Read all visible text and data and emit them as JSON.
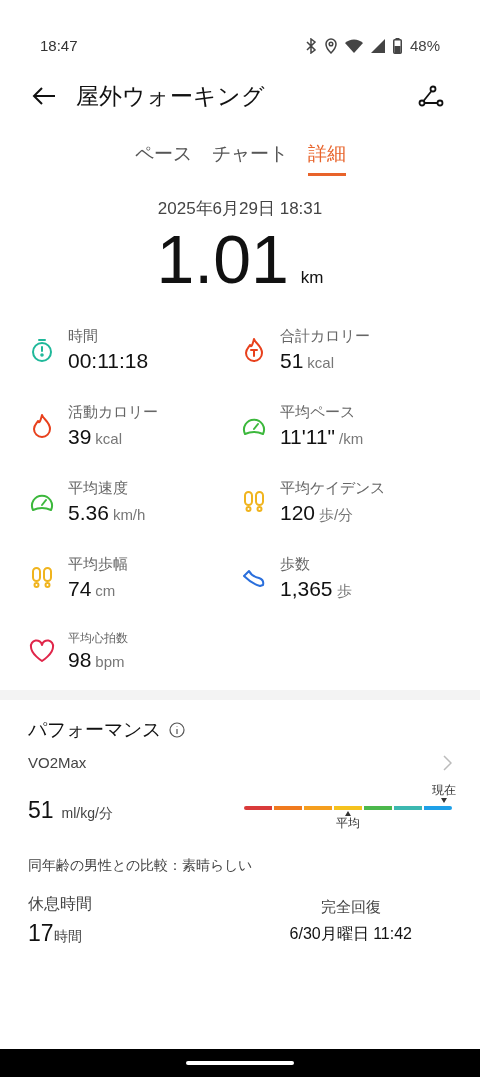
{
  "status_bar": {
    "time": "18:47",
    "battery": "48%"
  },
  "header": {
    "title": "屋外ウォーキング"
  },
  "tabs": [
    {
      "label": "ペース",
      "selected": false
    },
    {
      "label": "チャート",
      "selected": false
    },
    {
      "label": "詳細",
      "selected": true
    }
  ],
  "summary": {
    "datetime": "2025年6月29日 18:31",
    "distance": "1.01",
    "unit": "km"
  },
  "metrics": [
    {
      "kind": "stopwatch",
      "color": "#1fb89a",
      "label": "時間",
      "value": "00:11:18"
    },
    {
      "kind": "flame-t",
      "color": "#e8401c",
      "label": "合計カロリー",
      "value": "51",
      "unit": "kcal"
    },
    {
      "kind": "flame",
      "color": "#e8401c",
      "label": "活動カロリー",
      "value": "39",
      "unit": "kcal"
    },
    {
      "kind": "gauge",
      "color": "#3cb83c",
      "label": "平均ペース",
      "value": "11'11\"",
      "unit": "/km"
    },
    {
      "kind": "gauge",
      "color": "#3cb83c",
      "label": "平均速度",
      "value": "5.36",
      "unit": "km/h"
    },
    {
      "kind": "footprints",
      "color": "#f0b41e",
      "label": "平均ケイデンス",
      "value": "120",
      "unit": "歩/分"
    },
    {
      "kind": "footprints",
      "color": "#f0b41e",
      "label": "平均歩幅",
      "value": "74",
      "unit": "cm"
    },
    {
      "kind": "shoe",
      "color": "#2a6fdc",
      "label": "歩数",
      "value": "1,365",
      "unit": "歩"
    },
    {
      "kind": "heart",
      "color": "#e0264a",
      "label": "平均心拍数",
      "value": "98",
      "unit": "bpm",
      "small_label": true
    }
  ],
  "performance": {
    "title": "パフォーマンス",
    "metric": "VO2Max",
    "value": "51",
    "unit": "ml/kg/分",
    "scale": {
      "segments": [
        {
          "color": "#d93a3a"
        },
        {
          "color": "#f07a1e"
        },
        {
          "color": "#f59e1e"
        },
        {
          "color": "#f5c21e"
        },
        {
          "color": "#4cb84c"
        },
        {
          "color": "#3cb8b0"
        },
        {
          "color": "#1ea0e8"
        }
      ],
      "current": {
        "label": "現在"
      },
      "average": {
        "label": "平均"
      }
    },
    "comparison": "同年齢の男性との比較：素晴らしい",
    "rest": {
      "label": "休息時間",
      "value": "17",
      "unit": "時間"
    },
    "recovery": {
      "label": "完全回復",
      "value": "6/30月曜日 11:42"
    }
  }
}
